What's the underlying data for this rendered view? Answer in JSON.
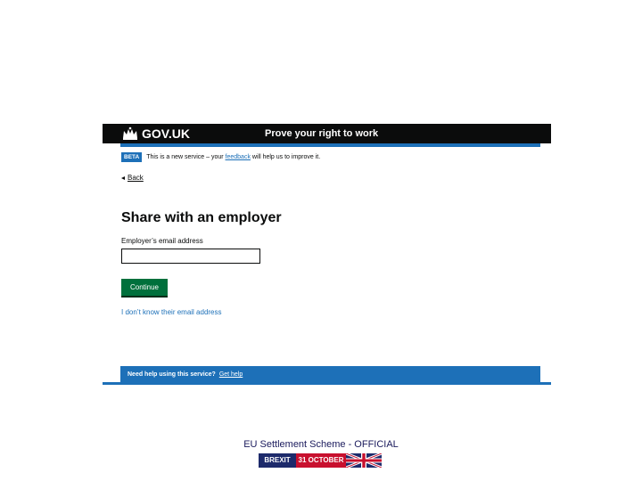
{
  "header": {
    "logo_text": "GOV.UK",
    "service_name": "Prove your right to work",
    "logo_icon": "crown-icon"
  },
  "phase_banner": {
    "tag": "BETA",
    "text_before": "This is a new service – your ",
    "link": "feedback",
    "text_after": " will help us to improve it."
  },
  "back_link": "Back",
  "page_title": "Share with an employer",
  "email_field": {
    "label": "Employer’s email address",
    "value": ""
  },
  "continue_button": "Continue",
  "unknown_email_link": "I don’t know their email address",
  "footer": {
    "help_text": "Need help using this service?",
    "help_link": "Get help"
  },
  "slide_caption": "EU Settlement Scheme - OFFICIAL",
  "campaign_badge": {
    "left_text": "BREXIT",
    "right_text": "31 OCTOBER",
    "flag_icon": "union-flag-icon"
  },
  "colors": {
    "header_black": "#0b0c0c",
    "govuk_blue": "#1d70b8",
    "button_green": "#00703c",
    "badge_navy": "#1d2a6b",
    "badge_red": "#c8102e"
  }
}
